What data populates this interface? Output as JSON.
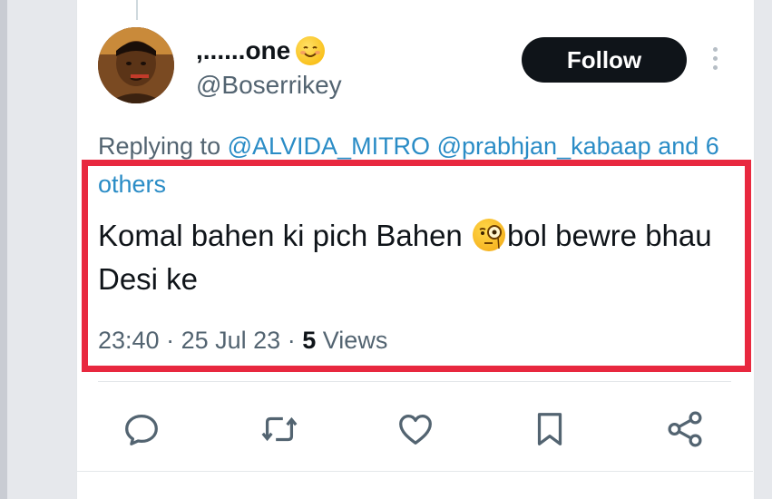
{
  "tweet": {
    "display_name": ",......one",
    "handle": "@Boserrikey",
    "follow_label": "Follow",
    "replying_prefix": "Replying to",
    "mentions": [
      "@ALVIDA_MITRO",
      "@prabhjan_kabaap"
    ],
    "others": "and 6 others",
    "text_part1": "Komal bahen ki pich Bahen",
    "text_part2": "bol bewre bhau Desi ke",
    "time": "23:40",
    "date": "25 Jul 23",
    "views_count": "5",
    "views_label": "Views",
    "separator": "·"
  },
  "colors": {
    "highlight": "#e8283f",
    "mention": "#2a8cc6",
    "follow_bg": "#0f1419",
    "secondary_text": "#536471"
  },
  "icons": {
    "reply": "reply-icon",
    "retweet": "retweet-icon",
    "like": "heart-icon",
    "bookmark": "bookmark-icon",
    "share": "share-icon",
    "more": "more-vertical-icon"
  }
}
